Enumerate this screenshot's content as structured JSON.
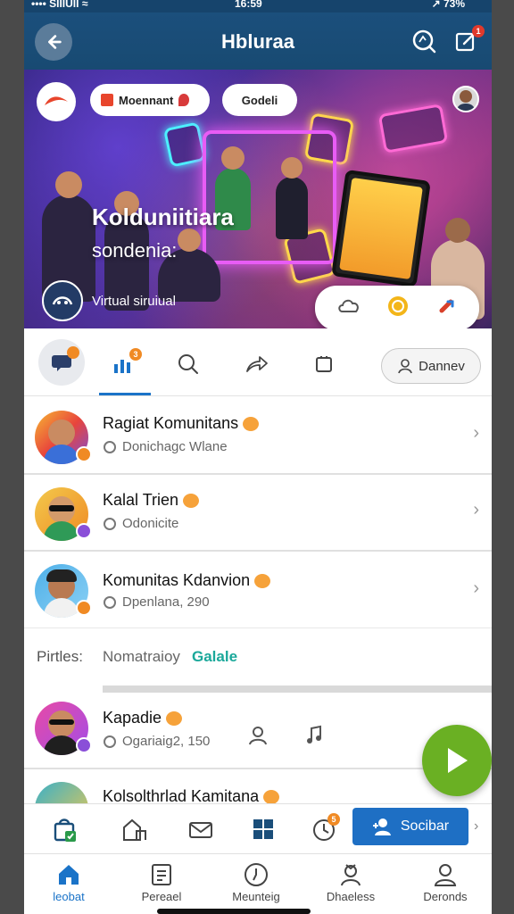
{
  "status_bar": {
    "carrier": "•••• SIIIUII ≈",
    "time": "16:59",
    "battery": "↗ 73%"
  },
  "header": {
    "title": "Hbluraa",
    "notification_count": "1"
  },
  "banner": {
    "pill_1": "Moennant",
    "pill_2": "Godeli",
    "title": "Kolduniitiara",
    "subtitle": "sondenia:",
    "tag": "Virtual siruiual"
  },
  "tabs": {
    "active_badge": "3",
    "user_pill": "Dannev"
  },
  "list": [
    {
      "title": "Ragiat Komunitans",
      "subtitle": "Donichagc Wlane"
    },
    {
      "title": "Kalal Trien",
      "subtitle": "Odonicite"
    },
    {
      "title": "Komunitas Kdanvion",
      "subtitle": "Dpenlana, 290"
    }
  ],
  "filter": {
    "label": "Pirtles:",
    "option": "Nomatraioy",
    "highlight": "Galale"
  },
  "list_extra": [
    {
      "title": "Kapadie",
      "subtitle": "Ogariaig2, 150"
    },
    {
      "title": "Kolsolthrlad Kamitana",
      "subtitle": ""
    }
  ],
  "action_strip": {
    "button_label": "Socibar",
    "notif_count": "5"
  },
  "bottom_nav": [
    {
      "label": "leobat"
    },
    {
      "label": "Pereael"
    },
    {
      "label": "Meunteig"
    },
    {
      "label": "Dhaeless"
    },
    {
      "label": "Deronds"
    }
  ],
  "colors": {
    "header": "#184a72",
    "accent": "#1a73c8",
    "fab": "#6ab023",
    "action_button": "#1e6fc4"
  }
}
